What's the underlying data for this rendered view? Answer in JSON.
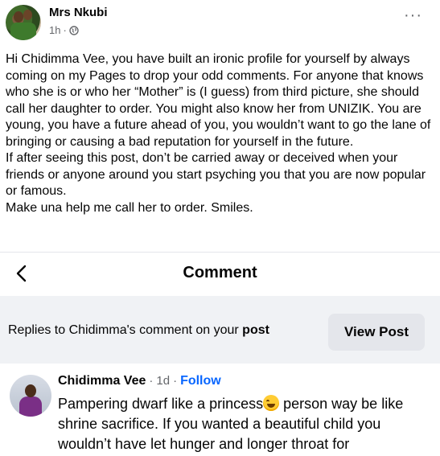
{
  "post": {
    "author": "Mrs Nkubi",
    "time": "1h",
    "visibility_icon": "globe-icon",
    "more_icon": "ellipsis-icon",
    "more_label": "···",
    "body": "Hi Chidimma Vee, you have built an ironic profile for yourself by always coming on my Pages to drop your odd comments. For anyone that knows who she is or who her “Mother” is (I guess) from third picture, she should call her daughter to order. You might also know her from UNIZIK. You are young, you have a future ahead of you, you wouldn’t want to go the lane of bringing or causing a bad reputation for yourself in the future.\nIf after seeing this post, don’t be carried away or deceived when your friends or anyone around you start psyching you that you are now popular or famous.\nMake una help me call her to order. Smiles."
  },
  "comment_header": {
    "back_icon": "chevron-left-icon",
    "title": "Comment"
  },
  "replies_bar": {
    "prefix": "Replies to Chidimma's comment on your ",
    "bold": "post",
    "button": "View Post"
  },
  "comment": {
    "name": "Chidimma Vee",
    "separator": "·",
    "time": "1d",
    "follow": "Follow",
    "text_before_emoji": "Pampering dwarf like a princess",
    "emoji": "rolling-on-floor-laughing-emoji",
    "text_after_emoji": " person way be like shrine sacrifice. If you wanted a beautiful child you wouldn’t have let hunger and longer throat for"
  },
  "colors": {
    "link_blue": "#0866ff",
    "secondary_text": "#65676b",
    "bar_bg": "#f0f2f5",
    "button_bg": "#e4e6eb"
  }
}
